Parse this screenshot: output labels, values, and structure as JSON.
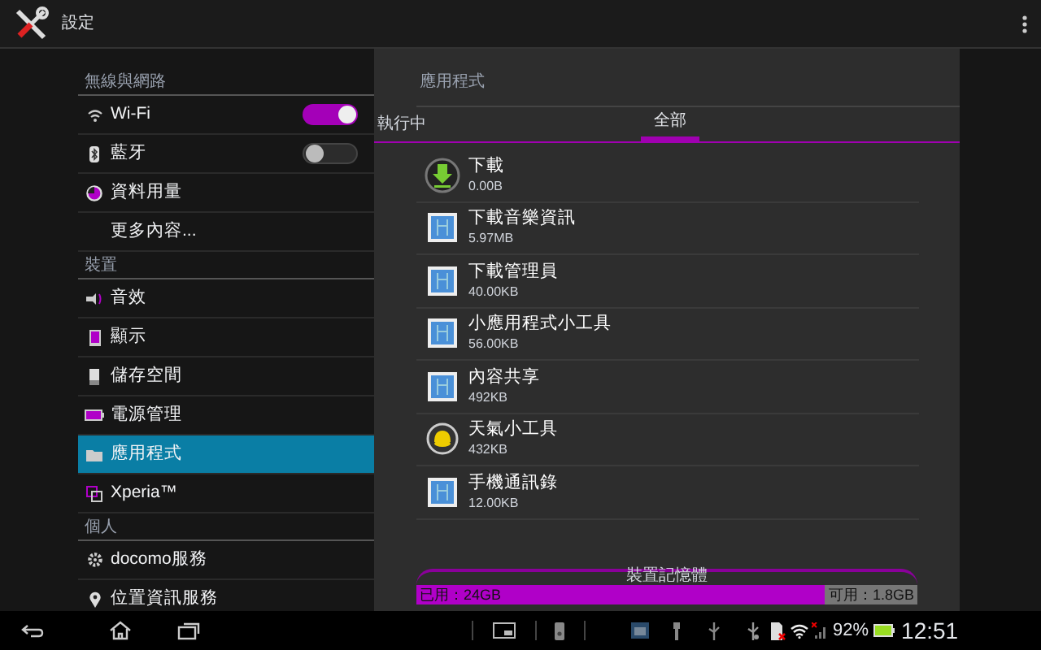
{
  "action_bar": {
    "title": "設定"
  },
  "sidebar": {
    "items": [
      {
        "kind": "header",
        "label": "無線與網路"
      },
      {
        "kind": "toggle",
        "label": "Wi-Fi",
        "on": true,
        "selected": false
      },
      {
        "kind": "toggle",
        "label": "藍牙",
        "on": false,
        "selected": false
      },
      {
        "kind": "item",
        "label": "資料用量",
        "selected": false
      },
      {
        "kind": "item",
        "label": "更多內容...",
        "selected": false
      },
      {
        "kind": "header",
        "label": "裝置"
      },
      {
        "kind": "item",
        "label": "音效",
        "selected": false
      },
      {
        "kind": "item",
        "label": "顯示",
        "selected": false
      },
      {
        "kind": "item",
        "label": "儲存空間",
        "selected": false
      },
      {
        "kind": "item",
        "label": "電源管理",
        "selected": false
      },
      {
        "kind": "item",
        "label": "應用程式",
        "selected": true
      },
      {
        "kind": "item",
        "label": "Xperia™",
        "selected": false
      },
      {
        "kind": "header",
        "label": "個人"
      },
      {
        "kind": "item",
        "label": "docomo服務",
        "selected": false
      },
      {
        "kind": "item",
        "label": "位置資訊服務",
        "selected": false
      }
    ]
  },
  "panel": {
    "title": "應用程式",
    "tabs": [
      {
        "label": "執行中",
        "selected": false
      },
      {
        "label": "全部",
        "selected": true
      }
    ],
    "apps": [
      {
        "kind": "download",
        "name": "下載",
        "size": "0.00B"
      },
      {
        "kind": "generic",
        "name": "下載音樂資訊",
        "size": "5.97MB"
      },
      {
        "kind": "generic",
        "name": "下載管理員",
        "size": "40.00KB"
      },
      {
        "kind": "generic",
        "name": "小應用程式小工具",
        "size": "56.00KB"
      },
      {
        "kind": "generic",
        "name": "內容共享",
        "size": "492KB"
      },
      {
        "kind": "weather",
        "name": "天氣小工具",
        "size": "432KB"
      },
      {
        "kind": "generic",
        "name": "手機通訊錄",
        "size": "12.00KB"
      }
    ],
    "storage": {
      "label": "裝置記憶體",
      "used": "已用：24GB",
      "free": "可用：1.8GB",
      "level": 0.92
    }
  },
  "status_bar": {
    "battery": "92%",
    "time": "12:51"
  }
}
